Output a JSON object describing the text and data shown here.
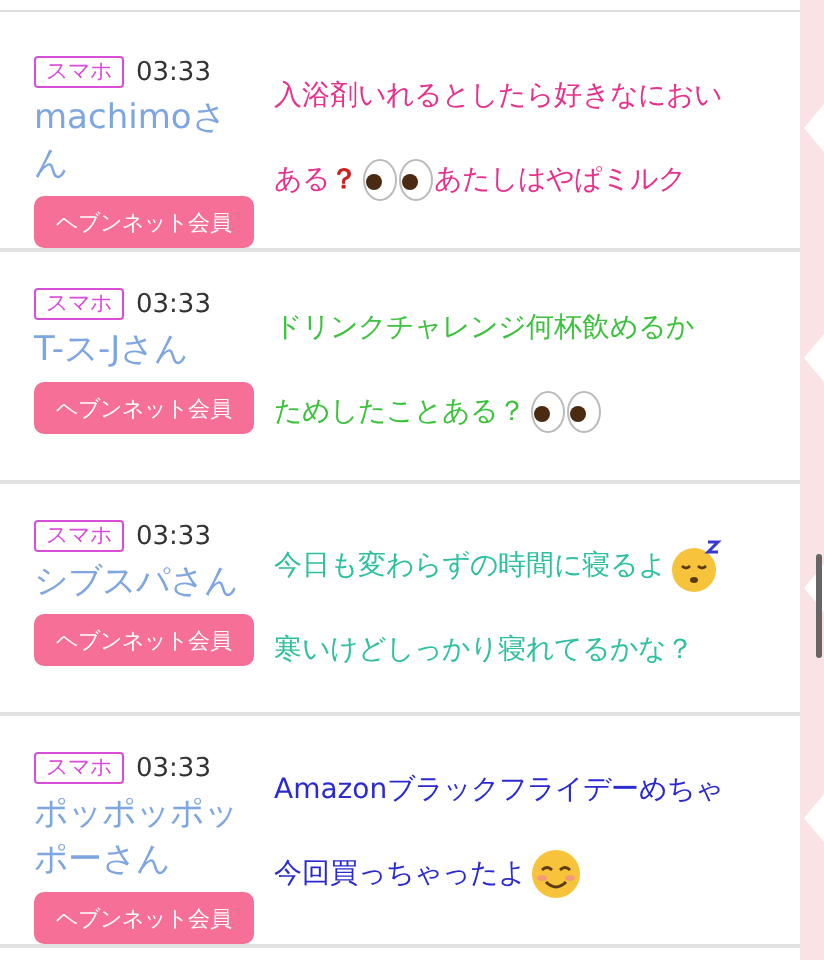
{
  "posts": [
    {
      "device": "スマホ",
      "time": "03:33",
      "user": "machimoさん",
      "member_button": "ヘブンネット会員",
      "caption": {
        "color": "#e8318c",
        "lines": [
          [
            {
              "kind": "text",
              "text": "入浴剤いれるとしたら好きなにおい"
            }
          ],
          [
            {
              "kind": "text",
              "text": "ある"
            },
            {
              "kind": "question",
              "text": "？"
            },
            {
              "kind": "eyes"
            },
            {
              "kind": "text",
              "text": "あたしはやぱミルク"
            }
          ]
        ]
      }
    },
    {
      "device": "スマホ",
      "time": "03:33",
      "user": "T-ス-Jさん",
      "member_button": "ヘブンネット会員",
      "caption": {
        "color": "#3cc23c",
        "lines": [
          [
            {
              "kind": "text",
              "text": "ドリンクチャレンジ何杯飲めるか"
            }
          ],
          [
            {
              "kind": "text",
              "text": "ためしたことある？"
            },
            {
              "kind": "eyes"
            }
          ]
        ]
      }
    },
    {
      "device": "スマホ",
      "time": "03:33",
      "user": "シブスパさん",
      "member_button": "ヘブンネット会員",
      "caption": {
        "color": "#2fc0a0",
        "lines": [
          [
            {
              "kind": "text",
              "text": "今日も変わらずの時間に寝るよ"
            },
            {
              "kind": "sleepy"
            }
          ],
          [
            {
              "kind": "text",
              "text": "寒いけどしっかり寝れてるかな？"
            }
          ]
        ]
      }
    },
    {
      "device": "スマホ",
      "time": "03:33",
      "user": "ポッポッポッポーさん",
      "member_button": "ヘブンネット会員",
      "caption": {
        "color": "#2a2ad0",
        "lines": [
          [
            {
              "kind": "text",
              "text": "Amazonブラックフライデーめちゃ"
            }
          ],
          [
            {
              "kind": "text",
              "text": "今回買っちゃったよ"
            },
            {
              "kind": "smile"
            }
          ]
        ]
      }
    }
  ]
}
